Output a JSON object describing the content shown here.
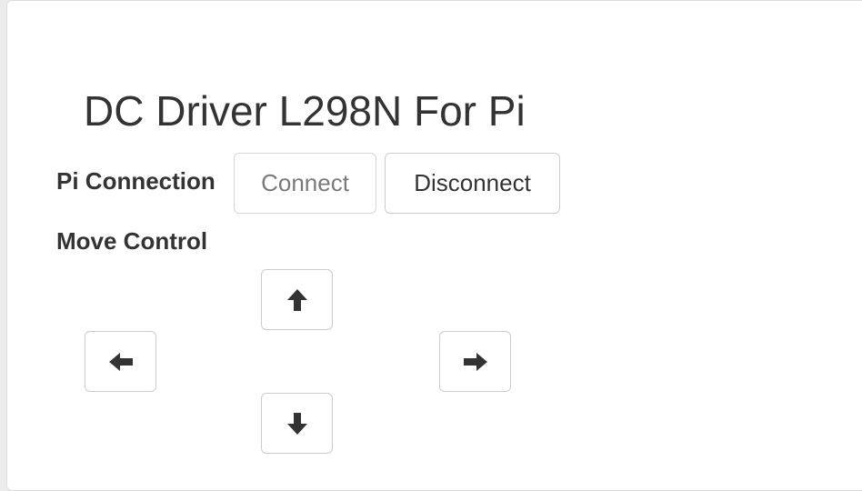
{
  "page": {
    "title": "DC Driver L298N For Pi"
  },
  "connection": {
    "label": "Pi Connection",
    "connect_label": "Connect",
    "disconnect_label": "Disconnect"
  },
  "move_control": {
    "label": "Move Control",
    "buttons": [
      {
        "direction": "up",
        "icon": "arrow-up-icon"
      },
      {
        "direction": "left",
        "icon": "arrow-left-icon"
      },
      {
        "direction": "right",
        "icon": "arrow-right-icon"
      },
      {
        "direction": "down",
        "icon": "arrow-down-icon"
      }
    ]
  },
  "colors": {
    "text": "#333333",
    "disabled_text": "#7a7a7a",
    "border": "#cccccc",
    "background": "#ffffff"
  }
}
